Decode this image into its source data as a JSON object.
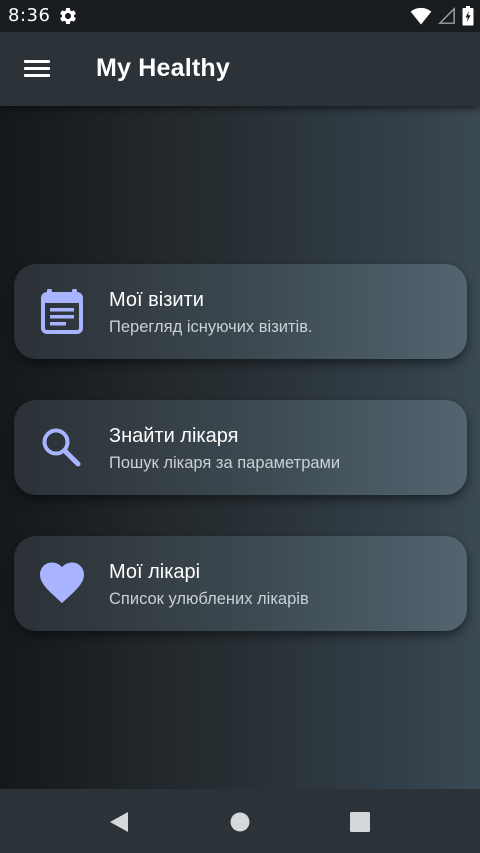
{
  "status_bar": {
    "time": "8:36",
    "icons": [
      "settings-gear-icon",
      "wifi-icon",
      "signal-icon",
      "battery-icon"
    ]
  },
  "app_bar": {
    "title": "My Healthy",
    "menu_icon": "hamburger-menu-icon"
  },
  "colors": {
    "accent": "#a8b4ff",
    "status_bar": "#1a1d20",
    "app_bar": "#2b3338",
    "nav_bar": "#2b3338",
    "card_subtitle": "#c9d1d6"
  },
  "cards": [
    {
      "title": "Мої візити",
      "subtitle": "Перегляд існуючих візитів.",
      "icon": "calendar-icon"
    },
    {
      "title": "Знайти лікаря",
      "subtitle": "Пошук лікаря за параметрами",
      "icon": "search-icon"
    },
    {
      "title": "Мої лікарі",
      "subtitle": "Список улюблених лікарів",
      "icon": "heart-icon"
    }
  ],
  "nav_bar": {
    "buttons": [
      "back-icon",
      "home-icon",
      "recents-icon"
    ]
  }
}
